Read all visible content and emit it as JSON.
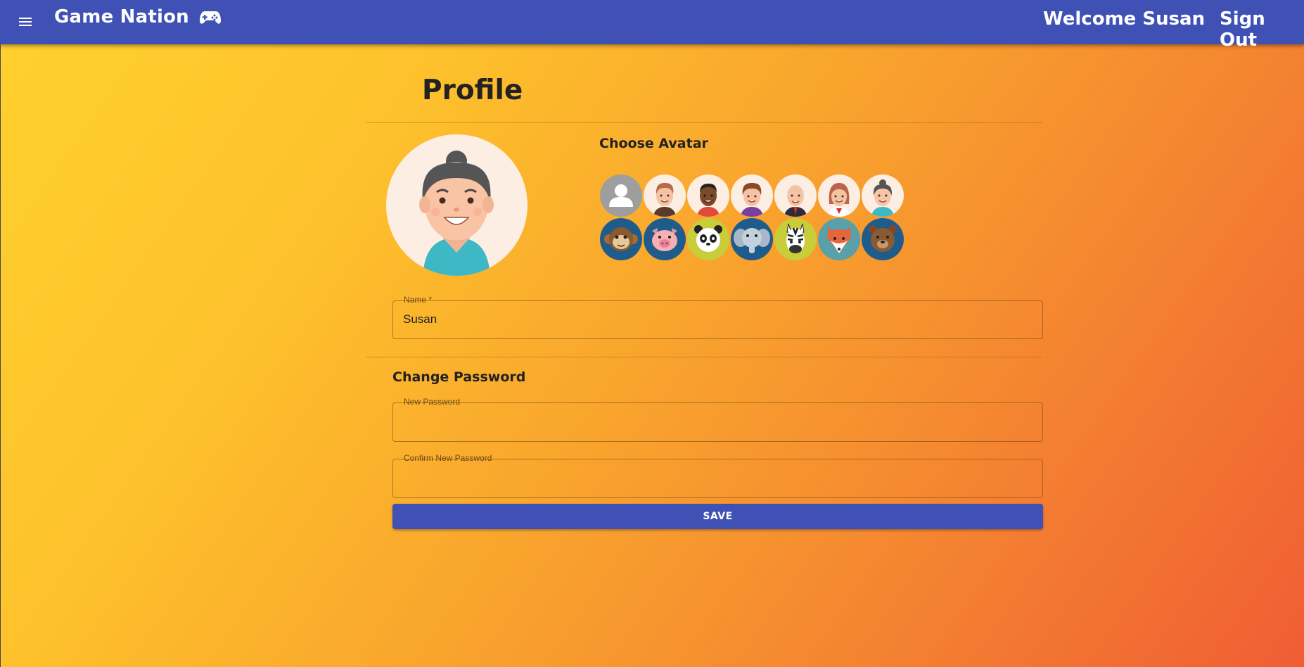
{
  "header": {
    "title": "Game Nation",
    "welcome": "Welcome Susan",
    "sign_out": "Sign Out",
    "menu_icon": "hamburger-menu-icon",
    "logo_icon": "gamepad-icon",
    "bar_color": "#3f51b5"
  },
  "profile": {
    "title": "Profile",
    "choose_avatar": "Choose Avatar",
    "selected_avatar": "woman-grey-bun",
    "avatars": [
      "default-user",
      "man-brown-hair",
      "man-dark-skin",
      "boy-brown-hair",
      "old-man-bald",
      "woman-red-hair",
      "woman-grey-bun",
      "monkey",
      "pig",
      "panda",
      "elephant",
      "zebra",
      "fox",
      "bear"
    ]
  },
  "form": {
    "name_label": "Name *",
    "name_value": "Susan",
    "change_password": "Change Password",
    "new_password_label": "New Password",
    "new_password_value": "",
    "confirm_password_label": "Confirm New Password",
    "confirm_password_value": "",
    "save_label": "SAVE"
  }
}
